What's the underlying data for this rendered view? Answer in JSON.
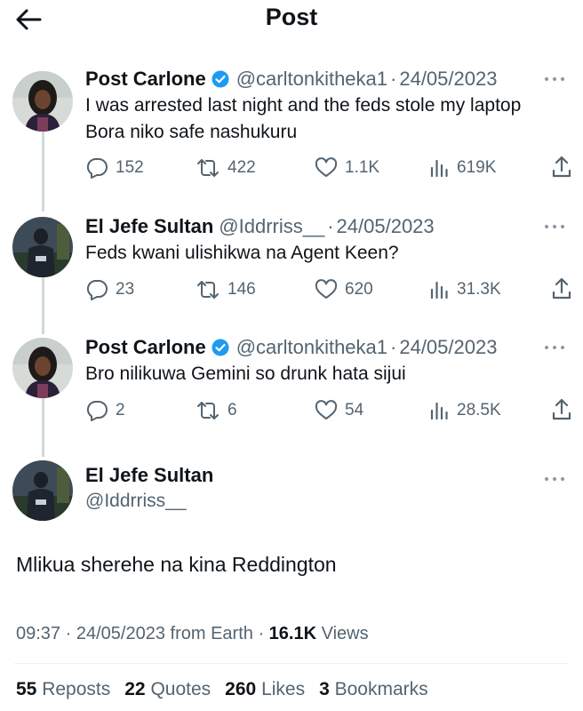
{
  "header": {
    "title": "Post"
  },
  "thread": [
    {
      "name": "Post Carlone",
      "verified": true,
      "handle": "@carltonkitheka1",
      "date": "24/05/2023",
      "lines": [
        "I was arrested last night and the feds stole my laptop",
        "Bora niko safe nashukuru"
      ],
      "replies": "152",
      "reposts": "422",
      "likes": "1.1K",
      "views": "619K"
    },
    {
      "name": "El Jefe Sultan",
      "verified": false,
      "handle": "@Iddrriss__",
      "date": "24/05/2023",
      "lines": [
        "Feds kwani ulishikwa na Agent Keen?"
      ],
      "replies": "23",
      "reposts": "146",
      "likes": "620",
      "views": "31.3K"
    },
    {
      "name": "Post Carlone",
      "verified": true,
      "handle": "@carltonkitheka1",
      "date": "24/05/2023",
      "lines": [
        "Bro nilikuwa Gemini so drunk hata sijui"
      ],
      "replies": "2",
      "reposts": "6",
      "likes": "54",
      "views": "28.5K"
    }
  ],
  "main_post": {
    "name": "El Jefe Sultan",
    "handle": "@Iddrriss__",
    "text": "Mlikua sherehe na kina Reddington",
    "time": "09:37",
    "date": "24/05/2023",
    "source": "from Earth",
    "views_count": "16.1K",
    "views_label": "Views",
    "reposts_count": "55",
    "reposts_label": "Reposts",
    "quotes_count": "22",
    "quotes_label": "Quotes",
    "likes_count": "260",
    "likes_label": "Likes",
    "bookmarks_count": "3",
    "bookmarks_label": "Bookmarks"
  },
  "colors": {
    "text": "#0f1419",
    "secondary": "#536471",
    "verified": "#1d9bf0",
    "thread_line": "#cfd9de"
  },
  "icons": [
    "back-arrow-icon",
    "verified-icon",
    "more-icon",
    "reply-icon",
    "repost-icon",
    "like-icon",
    "views-icon",
    "share-icon"
  ]
}
